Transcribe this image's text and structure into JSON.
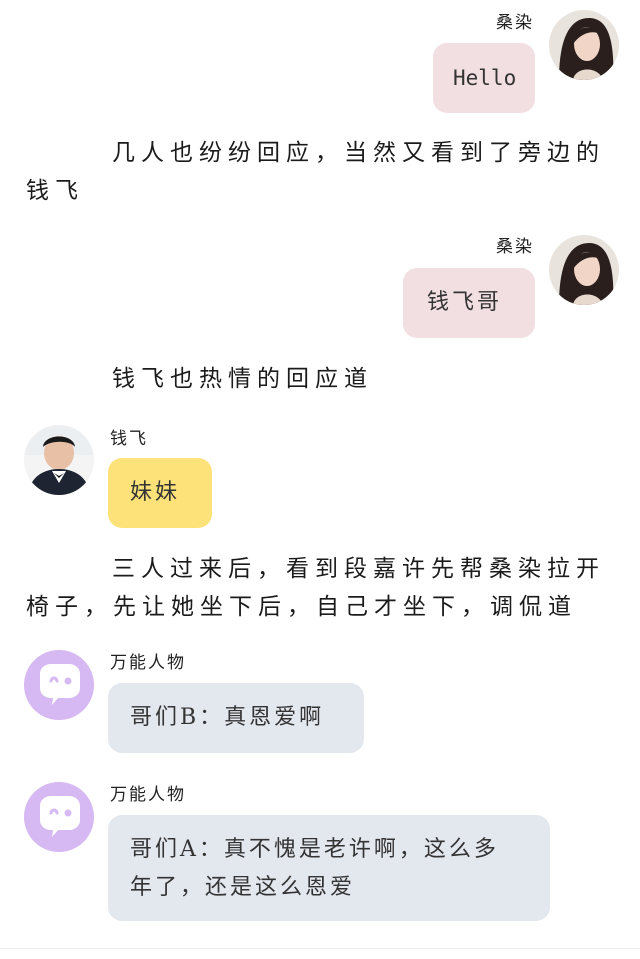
{
  "messages": [
    {
      "speaker": "桑染",
      "text": "Hello"
    },
    {
      "narration": "几人也纷纷回应，当然又看到了旁边的钱飞"
    },
    {
      "speaker": "桑染",
      "text": "钱飞哥"
    },
    {
      "narration": "钱飞也热情的回应道"
    },
    {
      "speaker": "钱飞",
      "text": "妹妹"
    },
    {
      "narration": "三人过来后，看到段嘉许先帮桑染拉开椅子，先让她坐下后，自己才坐下，调侃道"
    },
    {
      "speaker": "万能人物",
      "text": "哥们B：真恩爱啊"
    },
    {
      "speaker": "万能人物",
      "text": "哥们A：真不愧是老许啊，这么多年了，还是这么恩爱"
    }
  ],
  "narr": {
    "n1_line1": "几人也纷纷回应，当然又看到了旁边的",
    "n1_line2": "钱飞",
    "n2_line1": "钱飞也热情的回应道",
    "n3_line1": "三人过来后，看到段嘉许先帮桑染拉开",
    "n3_line2": "椅子，先让她坐下后，自己才坐下，调侃道"
  },
  "msg": {
    "m5_line1": "哥们A：真不愧是老许啊，这么多",
    "m5_line2": "年了，还是这么恩爱"
  },
  "colors": {
    "pink_bubble": "#f2dfe2",
    "yellow_bubble": "#fde27a",
    "gray_bubble": "#e3e7ee",
    "purple_avatar": "#d6b8f2"
  },
  "icons": {
    "robot_avatar": "chat-bubble-face-icon"
  }
}
